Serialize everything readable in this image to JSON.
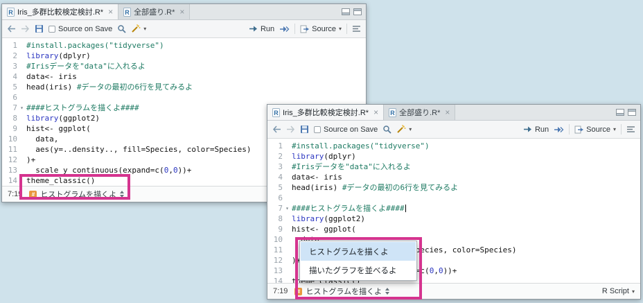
{
  "colors": {
    "background": "#cfe2eb",
    "highlight": "#d5348f",
    "comment": "#1d7a62",
    "keyword": "#2a35c0",
    "number": "#2a35c0",
    "selection": "#cfe4f7"
  },
  "icons": {
    "close": "×",
    "caret_down": "▾",
    "fold_marker": "▾",
    "section_hash": "#",
    "r_glyph": "R"
  },
  "tabs": [
    {
      "label": "Iris_多群比較検定検討.R*"
    },
    {
      "label": "全部盛り.R*"
    }
  ],
  "toolbar": {
    "source_on_save": "Source on Save",
    "run_label": "Run",
    "source_label": "Source"
  },
  "code": {
    "fold_line": 7,
    "lines": [
      {
        "num": "1",
        "segments": [
          {
            "t": "comment",
            "s": "#install.packages(\"tidyverse\")"
          }
        ]
      },
      {
        "num": "2",
        "segments": [
          {
            "t": "keyword",
            "s": "library"
          },
          {
            "t": "plain",
            "s": "(dplyr)"
          }
        ]
      },
      {
        "num": "3",
        "segments": [
          {
            "t": "comment",
            "s": "#Irisデータを\"data\"に入れるよ"
          }
        ]
      },
      {
        "num": "4",
        "segments": [
          {
            "t": "plain",
            "s": "data<- iris"
          }
        ]
      },
      {
        "num": "5",
        "segments": [
          {
            "t": "plain",
            "s": "head(iris) "
          },
          {
            "t": "comment",
            "s": "#データの最初の6行を見てみるよ"
          }
        ]
      },
      {
        "num": "6",
        "segments": []
      },
      {
        "num": "7",
        "segments": [
          {
            "t": "comment",
            "s": "####ヒストグラムを描くよ####"
          }
        ]
      },
      {
        "num": "8",
        "segments": [
          {
            "t": "keyword",
            "s": "library"
          },
          {
            "t": "plain",
            "s": "(ggplot2)"
          }
        ]
      },
      {
        "num": "9",
        "segments": [
          {
            "t": "plain",
            "s": "hist<- ggplot("
          }
        ]
      },
      {
        "num": "10",
        "segments": [
          {
            "t": "plain",
            "s": "  data,"
          }
        ]
      },
      {
        "num": "11",
        "segments": [
          {
            "t": "plain",
            "s": "  aes(y=..density.., fill=Species, color=Species)"
          }
        ]
      },
      {
        "num": "12",
        "segments": [
          {
            "t": "plain",
            "s": ")+"
          }
        ]
      },
      {
        "num": "13",
        "segments": [
          {
            "t": "plain",
            "s": "  scale_y_continuous(expand=c("
          },
          {
            "t": "number",
            "s": "0"
          },
          {
            "t": "plain",
            "s": ","
          },
          {
            "t": "number",
            "s": "0"
          },
          {
            "t": "plain",
            "s": "))+"
          }
        ]
      },
      {
        "num": "14",
        "segments": [
          {
            "t": "plain",
            "s": "theme_classic()"
          }
        ]
      }
    ]
  },
  "statusbar": {
    "position": "7:19",
    "nav_label": "ヒストグラムを描くよ",
    "file_type": "R Script"
  },
  "popup": {
    "items": [
      {
        "label": "ヒストグラムを描くよ",
        "selected": true
      },
      {
        "label": "描いたグラフを並べるよ",
        "selected": false
      }
    ]
  }
}
